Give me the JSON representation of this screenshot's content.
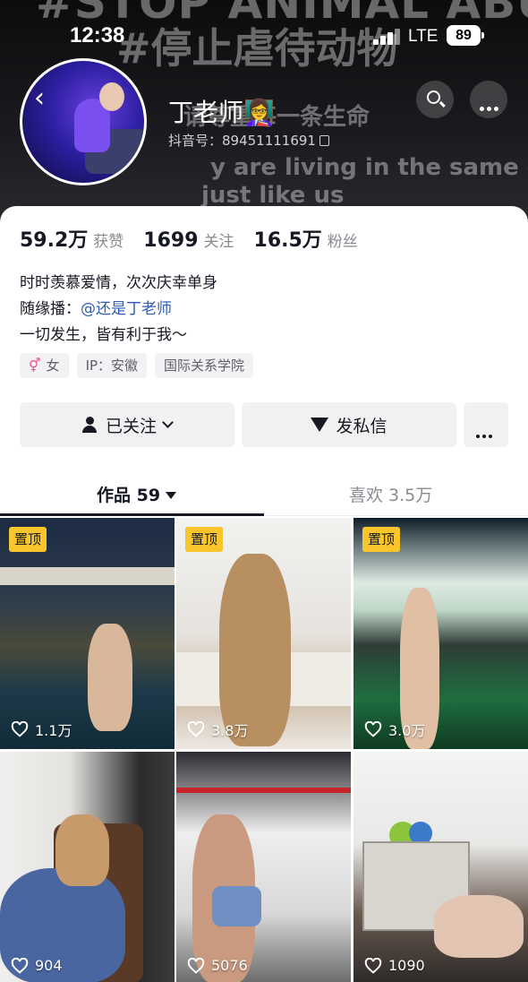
{
  "status_bar": {
    "time": "12:38",
    "network": "LTE",
    "battery": "89"
  },
  "header": {
    "banner_lines": [
      "#STOP ANIMAL ABUSE",
      "#停止虐待动物",
      "请尊重每一条生命",
      "y are living in the same earth",
      "just like us"
    ],
    "nickname": "丁老师👩‍🏫",
    "douyin_id": "抖音号：89451111691"
  },
  "stats": [
    {
      "value": "59.2万",
      "label": "获赞"
    },
    {
      "value": "1699",
      "label": "关注"
    },
    {
      "value": "16.5万",
      "label": "粉丝"
    }
  ],
  "bio": {
    "line1": "时时羡慕爱情，次次庆幸单身",
    "line2_prefix": "随缘播：",
    "line2_mention": "@还是丁老师",
    "line3": "一切发生，皆有利于我～"
  },
  "tags": {
    "gender": "女",
    "ip": "IP：安徽",
    "school": "国际关系学院"
  },
  "actions": {
    "follow": "已关注",
    "message": "发私信"
  },
  "tabs": {
    "works": "作品 59",
    "likes": "喜欢 3.5万"
  },
  "videos": [
    {
      "pinned": "置顶",
      "likes": "1.1万"
    },
    {
      "pinned": "置顶",
      "likes": "3.8万"
    },
    {
      "pinned": "置顶",
      "likes": "3.0万"
    },
    {
      "likes": "904"
    },
    {
      "likes": "5076"
    },
    {
      "likes": "1090"
    }
  ],
  "colors": {
    "accent_pin": "#f8c62c",
    "mention": "#2d5db8",
    "gender": "#f0508a"
  }
}
